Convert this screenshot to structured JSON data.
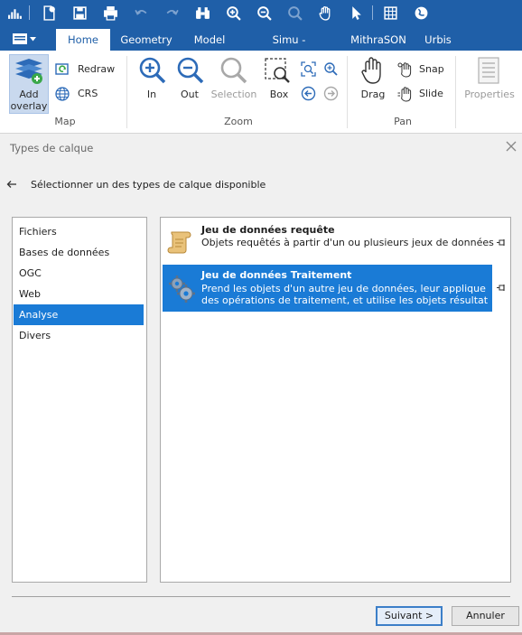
{
  "tabs": [
    {
      "label": "Home",
      "active": true
    },
    {
      "label": "Geometry"
    },
    {
      "label": "Model"
    },
    {
      "label": "Simu - Renderings"
    },
    {
      "label": "MithraSON"
    },
    {
      "label": "Urbis"
    }
  ],
  "ribbon": {
    "add_overlay": "Add overlay",
    "redraw": "Redraw",
    "crs": "CRS",
    "zoom_in": "In",
    "zoom_out": "Out",
    "zoom_selection": "Selection",
    "zoom_box": "Box",
    "drag": "Drag",
    "snap": "Snap",
    "slide": "Slide",
    "properties": "Properties",
    "group_map": "Map",
    "group_zoom": "Zoom",
    "group_pan": "Pan"
  },
  "dialog": {
    "title": "Types de calque",
    "instruction": "Sélectionner un des types de calque disponible",
    "categories": [
      "Fichiers",
      "Bases de données",
      "OGC",
      "Web",
      "Analyse",
      "Divers"
    ],
    "selected_category": "Analyse",
    "items": [
      {
        "title": "Jeu de données requête",
        "desc1": "Objets requêtés à partir d'un ou plusieurs jeux de données",
        "desc2": ""
      },
      {
        "title": "Jeu de données Traitement",
        "desc1": "Prend les objets d'un autre jeu de données, leur applique",
        "desc2": "des opérations de traitement, et utilise les objets résultat",
        "selected": true
      }
    ],
    "next_button": "Suivant >",
    "cancel_button": "Annuler"
  },
  "colors": {
    "titlebar": "#1f5fa8",
    "selection": "#1a7bd6"
  }
}
